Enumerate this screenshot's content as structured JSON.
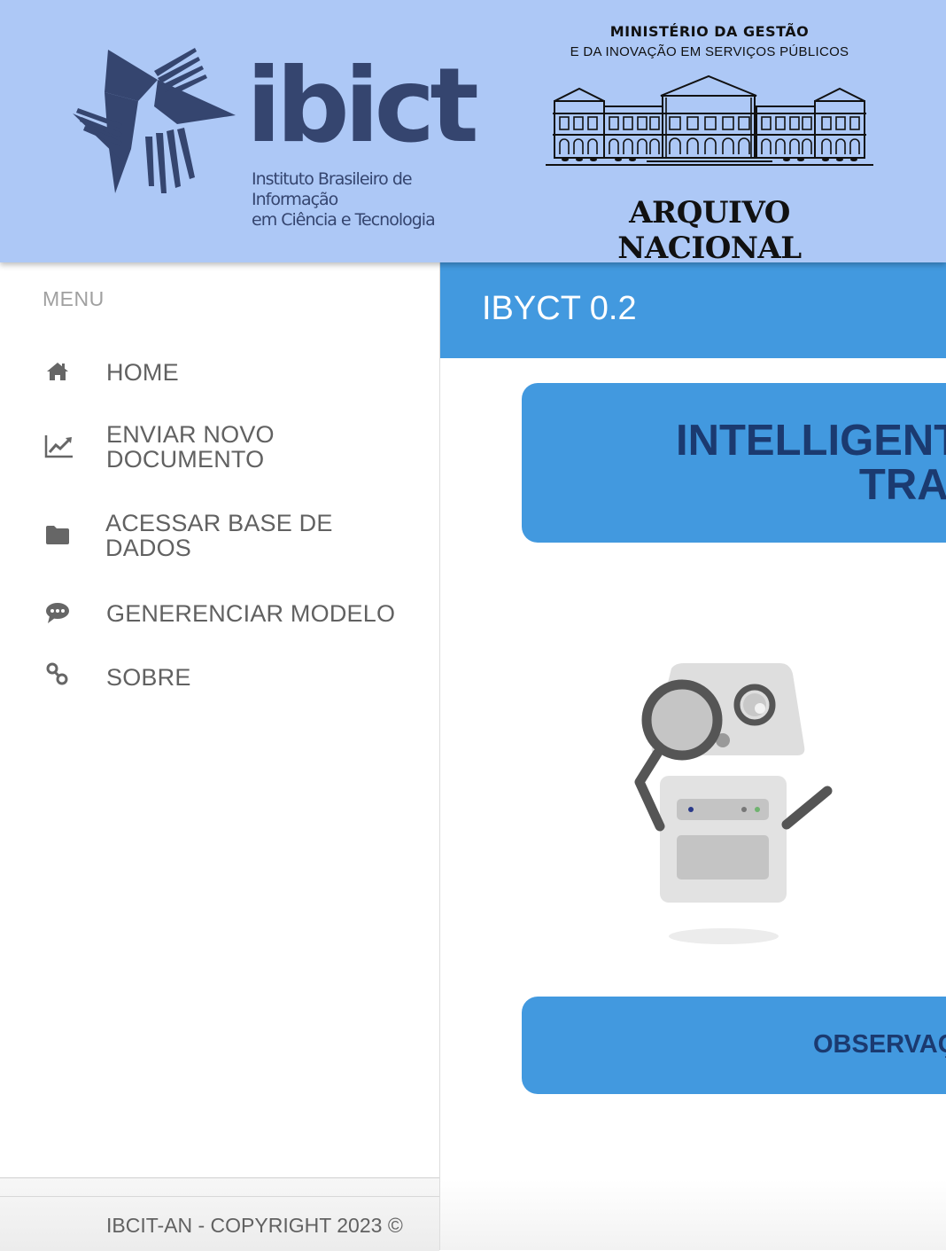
{
  "banner": {
    "ibict_wordmark": "ibict",
    "ibict_subtitle_line1": "Instituto Brasileiro de Informação",
    "ibict_subtitle_line2": "em Ciência e Tecnologia",
    "ministry_title": "MINISTÉRIO DA GESTÃO",
    "ministry_subtitle": "E DA INOVAÇÃO EM SERVIÇOS PÚBLICOS",
    "arquivo_name": "ARQUIVO NACIONAL"
  },
  "sidebar": {
    "menu_label": "MENU",
    "items": [
      {
        "label_line1": "HOME",
        "label_line2": "",
        "icon": "home-icon"
      },
      {
        "label_line1": "ENVIAR NOVO",
        "label_line2": "DOCUMENTO",
        "icon": "line-chart-icon"
      },
      {
        "label_line1": "ACESSAR BASE DE",
        "label_line2": "DADOS",
        "icon": "folder-icon"
      },
      {
        "label_line1": "GENERENCIAR MODELO",
        "label_line2": "",
        "icon": "chat-bubble-icon"
      },
      {
        "label_line1": "SOBRE",
        "label_line2": "",
        "icon": "link-icon"
      }
    ],
    "footer_text": "IBCIT-AN - COPYRIGHT 2023 ©"
  },
  "main": {
    "app_title": "IBYCT 0.2",
    "hero_line1": "INTELLIGENT",
    "hero_line2": "TRAI",
    "observation": "OBSERVAÇ"
  },
  "colors": {
    "banner_bg": "#adc8f6",
    "primary": "#4299df",
    "primary_text_dark": "#1b3a70",
    "logo_navy": "#35456f"
  }
}
